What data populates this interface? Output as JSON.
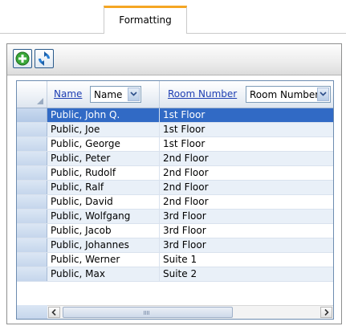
{
  "tabs": [
    {
      "label": "Formatting",
      "active": true
    }
  ],
  "toolbar": {
    "add_icon": "plus-circle-icon",
    "refresh_icon": "refresh-icon"
  },
  "grid": {
    "columns": [
      {
        "header_link": "Name",
        "filter_value": "Name"
      },
      {
        "header_link": "Room Number",
        "filter_value": "Room Number"
      }
    ],
    "rows": [
      {
        "name": "Public, John Q.",
        "room": "1st Floor",
        "selected": true
      },
      {
        "name": "Public, Joe",
        "room": "1st Floor"
      },
      {
        "name": "Public, George",
        "room": "1st Floor"
      },
      {
        "name": "Public, Peter",
        "room": "2nd Floor"
      },
      {
        "name": "Public, Rudolf",
        "room": "2nd Floor"
      },
      {
        "name": "Public, Ralf",
        "room": "2nd Floor"
      },
      {
        "name": "Public, David",
        "room": "2nd Floor"
      },
      {
        "name": "Public, Wolfgang",
        "room": "3rd Floor"
      },
      {
        "name": "Public, Jacob",
        "room": "3rd Floor"
      },
      {
        "name": "Public, Johannes",
        "room": "3rd Floor"
      },
      {
        "name": "Public, Werner",
        "room": "Suite 1"
      },
      {
        "name": "Public, Max",
        "room": "Suite 2"
      }
    ]
  },
  "colors": {
    "tab_accent": "#f5a623",
    "selection": "#316ac5",
    "link": "#1f3fb3",
    "alt_row": "#e9f0f8"
  }
}
